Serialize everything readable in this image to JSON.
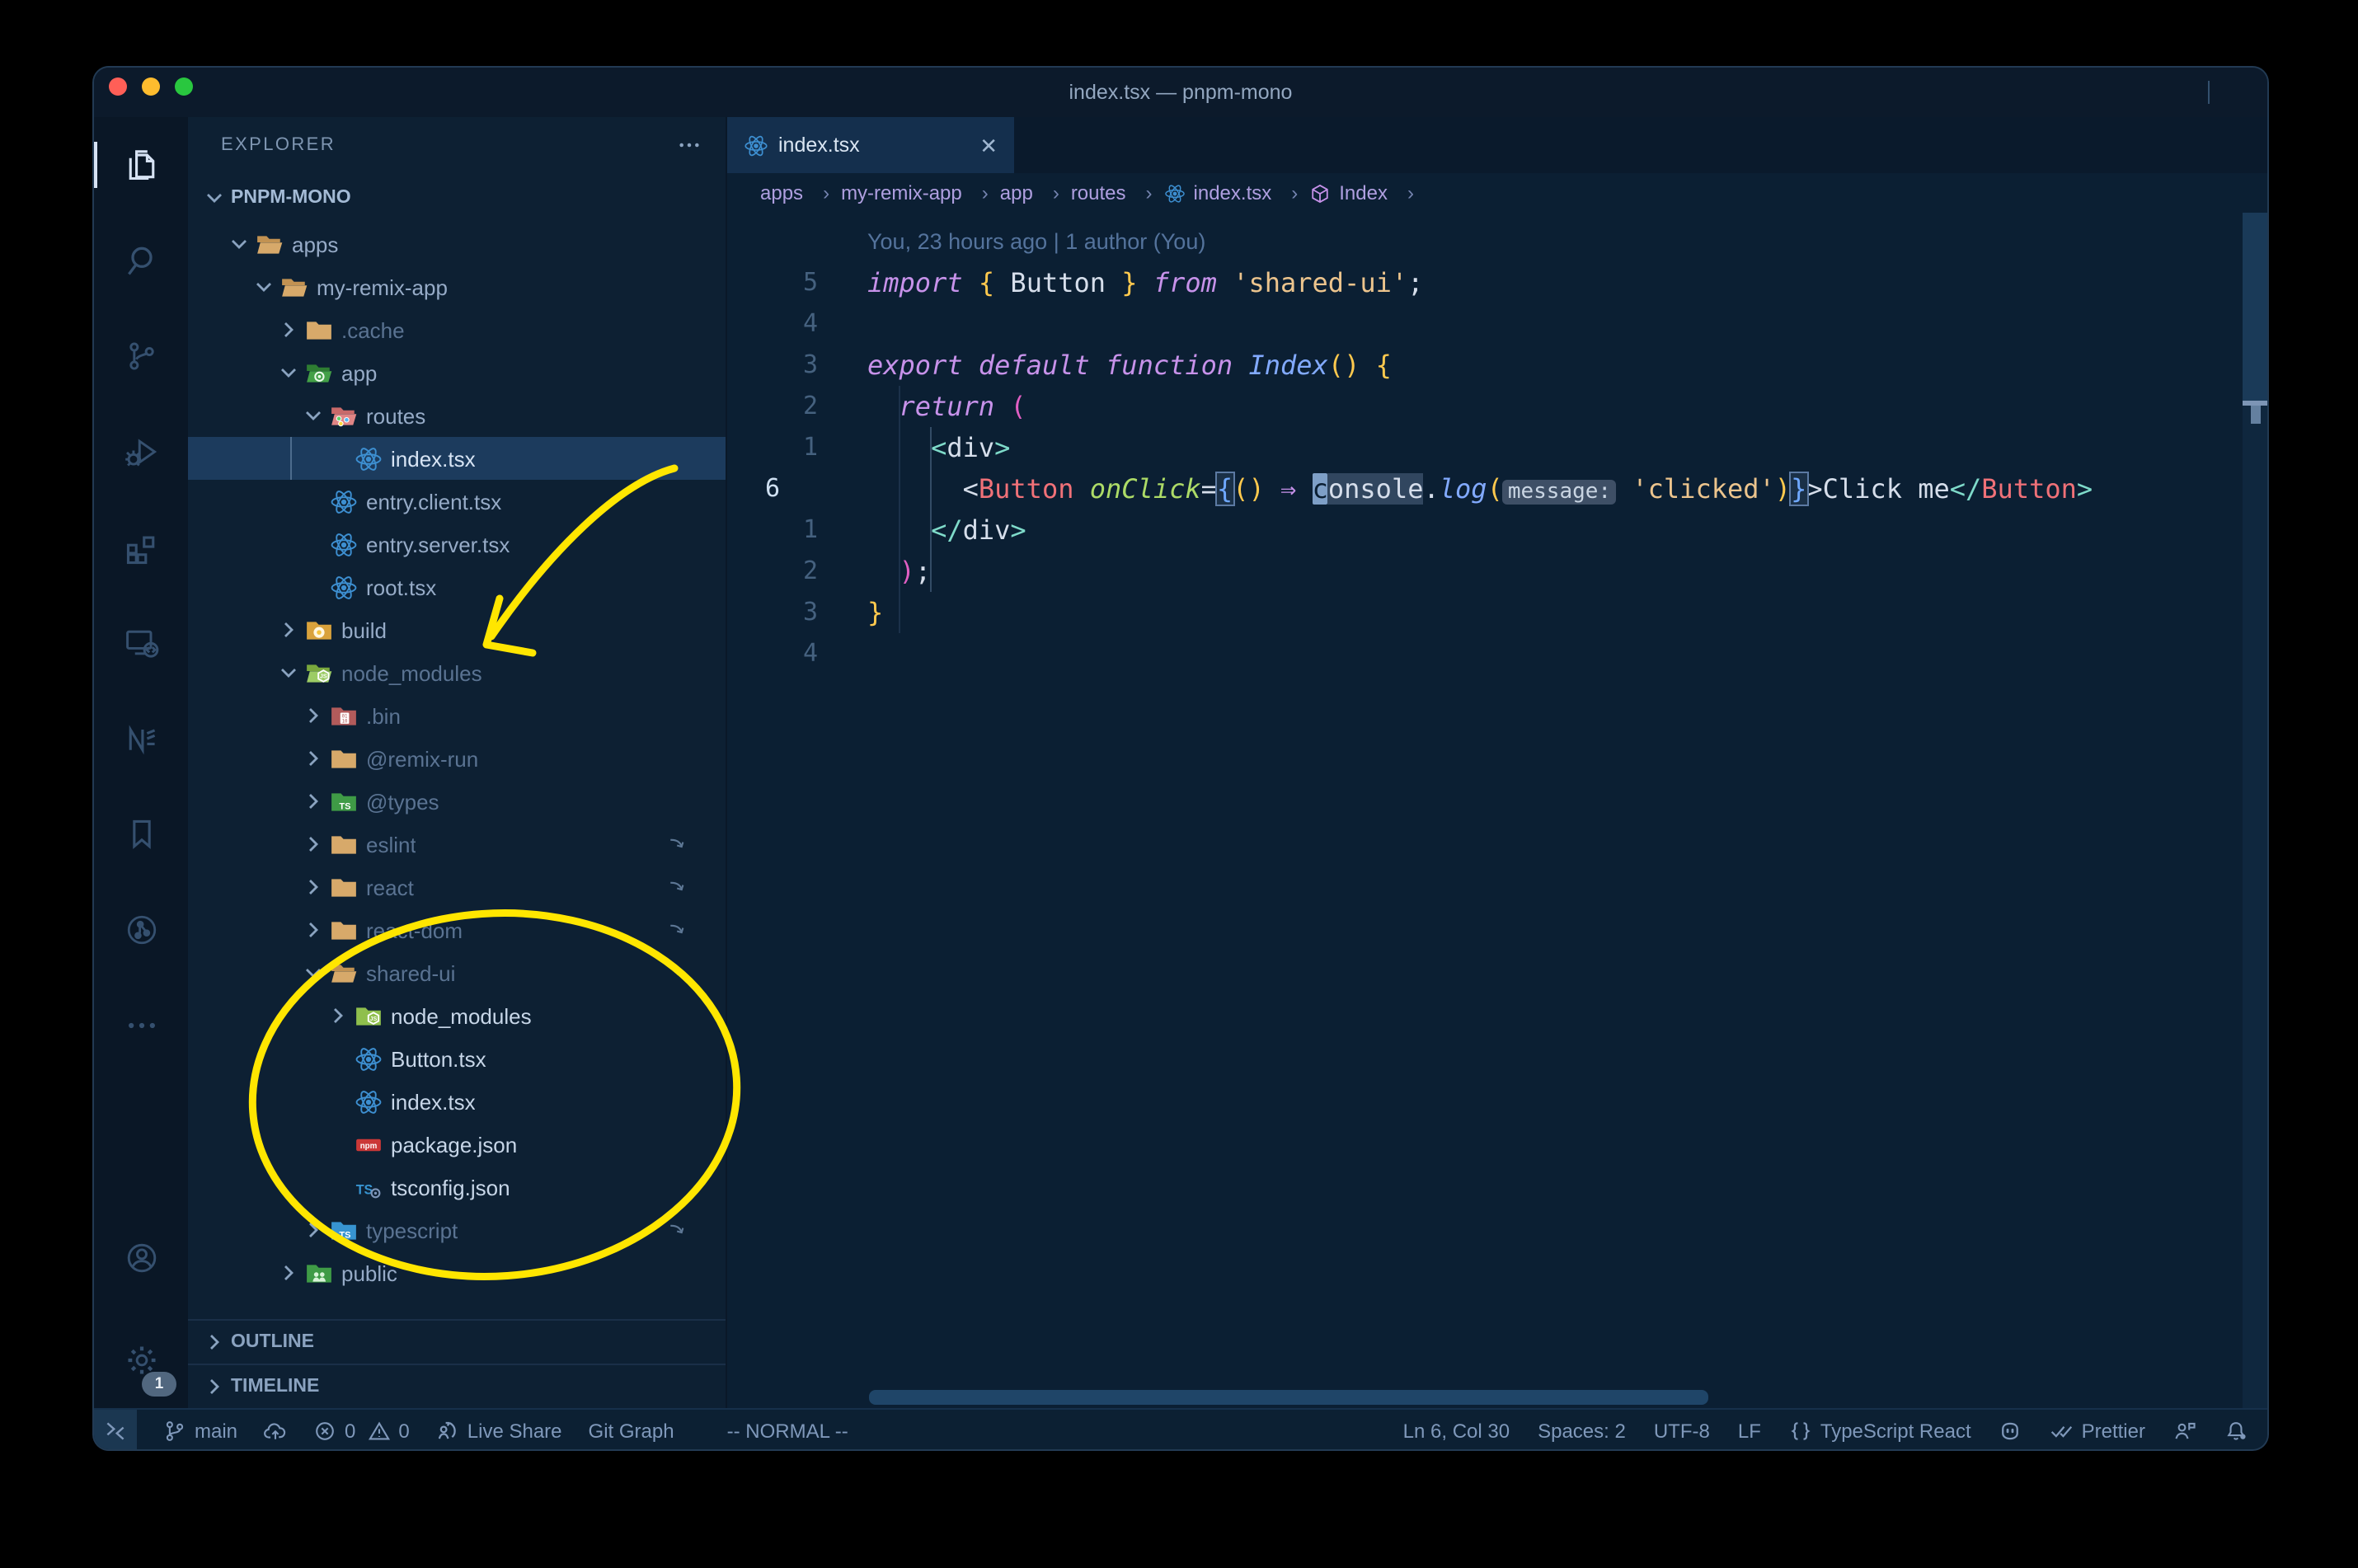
{
  "titlebar": {
    "title": "index.tsx — pnpm-mono",
    "traffic_lights": [
      "#ff5f57",
      "#febc2e",
      "#29c73f"
    ],
    "window_icons": [
      {
        "name": "toggle-primary-sidebar-button",
        "icon": "panel-left"
      },
      {
        "name": "toggle-panel-button",
        "icon": "panel-bottom"
      },
      {
        "name": "toggle-secondary-sidebar-button",
        "icon": "panel-right"
      },
      {
        "name": "divider",
        "icon": "",
        "cls": "divider"
      },
      {
        "name": "customize-layout-button",
        "icon": "layout"
      }
    ]
  },
  "activity_bar": {
    "items": [
      {
        "name": "activity-explorer",
        "icon": "files",
        "cls": "active"
      },
      {
        "name": "activity-search",
        "icon": "search"
      },
      {
        "name": "activity-source-control",
        "icon": "scm"
      },
      {
        "name": "activity-run-debug",
        "icon": "debug"
      },
      {
        "name": "activity-extensions",
        "icon": "extensions"
      },
      {
        "name": "activity-remote-explorer",
        "icon": "remote-explorer"
      },
      {
        "name": "activity-nx-console",
        "icon": "nx"
      },
      {
        "name": "activity-bookmarks",
        "icon": "bookmark"
      },
      {
        "name": "activity-git-graph",
        "icon": "graph-circle"
      },
      {
        "name": "activity-more",
        "icon": "more"
      }
    ],
    "settings_badge": "1"
  },
  "sidebar": {
    "header": "EXPLORER",
    "more_icon": "more",
    "section": "PNPM-MONO",
    "section_chevron": "chev-down",
    "tree": [
      {
        "name": "tree-folder-apps",
        "label": "apps",
        "depth": 1,
        "chev": "chev-down",
        "icon": "folder-open"
      },
      {
        "name": "tree-folder-my-remix-app",
        "label": "my-remix-app",
        "depth": 2,
        "chev": "chev-down",
        "icon": "folder-open"
      },
      {
        "name": "tree-folder-cache",
        "label": ".cache",
        "depth": 3,
        "chev": "chev-right",
        "ic4on": "",
        "icon": "folder",
        "cls": "dim"
      },
      {
        "name": "tree-folder-app",
        "label": "app",
        "depth": 3,
        "chev": "chev-down",
        "icon": "folder-app"
      },
      {
        "name": "tree-folder-routes",
        "label": "routes",
        "depth": 4,
        "chev": "chev-down",
        "icon": "folder-routes"
      },
      {
        "name": "tree-file-index-tsx",
        "label": "index.tsx",
        "depth": 5,
        "icon": "react",
        "cls": "selected"
      },
      {
        "name": "tree-file-entry-client",
        "label": "entry.client.tsx",
        "depth": 4,
        "icon": "react"
      },
      {
        "name": "tree-file-entry-server",
        "label": "entry.server.tsx",
        "depth": 4,
        "icon": "react"
      },
      {
        "name": "tree-file-root-tsx",
        "label": "root.tsx",
        "depth": 4,
        "icon": "react"
      },
      {
        "name": "tree-folder-build",
        "label": "build",
        "depth": 3,
        "chev": "chev-right",
        "icon": "folder-build"
      },
      {
        "name": "tree-folder-node-modules",
        "label": "node_modules",
        "depth": 3,
        "chev": "chev-down",
        "icon": "folder-node-open",
        "cls": "dim"
      },
      {
        "name": "tree-folder-bin",
        "label": ".bin",
        "depth": 4,
        "chev": "chev-right",
        "icon": "folder-bin",
        "cls": "dim"
      },
      {
        "name": "tree-folder-remix-run",
        "label": "@remix-run",
        "depth": 4,
        "chev": "chev-right",
        "icon": "folder",
        "cls": "dim"
      },
      {
        "name": "tree-folder-types",
        "label": "@types",
        "depth": 4,
        "chev": "chev-right",
        "icon": "folder-types",
        "cls": "dim"
      },
      {
        "name": "tree-folder-eslint",
        "label": "eslint",
        "depth": 4,
        "chev": "chev-right",
        "icon": "folder",
        "cls": "dim",
        "link": "symlink"
      },
      {
        "name": "tree-folder-react",
        "label": "react",
        "depth": 4,
        "chev": "chev-right",
        "icon": "folder",
        "cls": "dim",
        "link": "symlink"
      },
      {
        "name": "tree-folder-react-dom",
        "label": "react-dom",
        "depth": 4,
        "chev": "chev-right",
        "icon": "folder",
        "cls": "dim",
        "link": "symlink"
      },
      {
        "name": "tree-folder-shared-ui",
        "label": "shared-ui",
        "depth": 4,
        "chev": "chev-down",
        "icon": "folder-open",
        "cls": "dim",
        "link": "symlink"
      },
      {
        "name": "tree-folder-shared-node-modules",
        "label": "node_modules",
        "depth": 5,
        "chev": "chev-right",
        "icon": "folder-node",
        "cls": "bright"
      },
      {
        "name": "tree-file-button-tsx",
        "label": "Button.tsx",
        "depth": 5,
        "icon": "react",
        "cls": "bright"
      },
      {
        "name": "tree-file-shared-index-tsx",
        "label": "index.tsx",
        "depth": 5,
        "icon": "react",
        "cls": "bright"
      },
      {
        "name": "tree-file-package-json",
        "label": "package.json",
        "depth": 5,
        "icon": "npm",
        "cls": "bright"
      },
      {
        "name": "tree-file-tsconfig-json",
        "label": "tsconfig.json",
        "depth": 5,
        "icon": "tsconfig",
        "cls": "bright"
      },
      {
        "name": "tree-folder-typescript",
        "label": "typescript",
        "depth": 4,
        "chev": "chev-right",
        "icon": "folder-ts",
        "cls": "dim",
        "link": "symlink"
      },
      {
        "name": "tree-folder-public",
        "label": "public",
        "depth": 3,
        "chev": "chev-right",
        "icon": "folder-public"
      }
    ],
    "outline_label": "OUTLINE",
    "timeline_label": "TIMELINE",
    "panel_chevron": "chev-right"
  },
  "tab": {
    "icon": "react",
    "label": "index.tsx",
    "close": "✕"
  },
  "editor_actions": [
    {
      "name": "timeline-history-button",
      "icon": "history"
    },
    {
      "name": "previous-change-button",
      "icon": "prev-change"
    },
    {
      "name": "open-changes-button",
      "icon": "cur-change"
    },
    {
      "name": "next-change-button",
      "icon": "next-change"
    },
    {
      "name": "gitlens-graph-button",
      "icon": "graph-circle"
    },
    {
      "name": "split-editor-button",
      "icon": "split"
    },
    {
      "name": "more-actions-button",
      "icon": "more"
    }
  ],
  "breadcrumbs": [
    {
      "text": "apps"
    },
    {
      "text": "my-remix-app"
    },
    {
      "text": "app"
    },
    {
      "text": "routes"
    },
    {
      "icon": "react",
      "text": "index.tsx"
    },
    {
      "icon": "symbol-cube",
      "text": "Index"
    }
  ],
  "editor": {
    "blame": "You, 23 hours ago | 1 author (You)",
    "lines": [
      {
        "num": "5",
        "tokens": [
          {
            "t": "import",
            "c": "kw"
          },
          {
            "t": " ",
            "c": "w"
          },
          {
            "t": "{",
            "c": "y"
          },
          {
            "t": " Button ",
            "c": "w"
          },
          {
            "t": "}",
            "c": "y"
          },
          {
            "t": " ",
            "c": "w"
          },
          {
            "t": "from",
            "c": "kw"
          },
          {
            "t": " ",
            "c": "w"
          },
          {
            "t": "'shared-ui'",
            "c": "s"
          },
          {
            "t": ";",
            "c": "w"
          }
        ]
      },
      {
        "num": "4",
        "tokens": []
      },
      {
        "num": "3",
        "tokens": [
          {
            "t": "export",
            "c": "kw"
          },
          {
            "t": " ",
            "c": "w"
          },
          {
            "t": "default",
            "c": "kw"
          },
          {
            "t": " ",
            "c": "w"
          },
          {
            "t": "function",
            "c": "kw"
          },
          {
            "t": " ",
            "c": "w"
          },
          {
            "t": "Index",
            "c": "fn"
          },
          {
            "t": "(",
            "c": "y"
          },
          {
            "t": ")",
            "c": "y"
          },
          {
            "t": " ",
            "c": "w"
          },
          {
            "t": "{",
            "c": "y"
          }
        ]
      },
      {
        "num": "2",
        "tokens": [
          {
            "t": "  ",
            "c": "w"
          },
          {
            "t": "return",
            "c": "kw"
          },
          {
            "t": " ",
            "c": "w"
          },
          {
            "t": "(",
            "c": "pk"
          }
        ]
      },
      {
        "num": "1",
        "tokens": [
          {
            "t": "    ",
            "c": "w"
          },
          {
            "t": "<",
            "c": "tg"
          },
          {
            "t": "div",
            "c": "w"
          },
          {
            "t": ">",
            "c": "tg"
          }
        ]
      },
      {
        "num": "6",
        "cls": "cur-line",
        "tokens": [
          {
            "t": "      ",
            "c": "w"
          },
          {
            "t": "<",
            "c": "w"
          },
          {
            "t": "Button",
            "c": "cm"
          },
          {
            "t": " ",
            "c": "w"
          },
          {
            "t": "onClick",
            "c": "at"
          },
          {
            "t": "=",
            "c": "w"
          },
          {
            "t": "{",
            "c": "bl mb"
          },
          {
            "t": "(",
            "c": "y"
          },
          {
            "t": ")",
            "c": "y"
          },
          {
            "t": " ",
            "c": "w"
          },
          {
            "t": "⇒",
            "c": "arw"
          },
          {
            "t": " ",
            "c": "w"
          },
          {
            "t": "c",
            "c": "cur"
          },
          {
            "t": "onsole",
            "c": "w hl"
          },
          {
            "t": ".",
            "c": "w"
          },
          {
            "t": "log",
            "c": "fn"
          },
          {
            "t": "(",
            "c": "y"
          },
          {
            "t": "message:",
            "c": "inlay"
          },
          {
            "t": " ",
            "c": "w"
          },
          {
            "t": "'clicked'",
            "c": "s"
          },
          {
            "t": ")",
            "c": "y"
          },
          {
            "t": "}",
            "c": "bl mb"
          },
          {
            "t": ">",
            "c": "w"
          },
          {
            "t": "Click me",
            "c": "w"
          },
          {
            "t": "</",
            "c": "tg"
          },
          {
            "t": "Button",
            "c": "cm"
          },
          {
            "t": ">",
            "c": "tg"
          }
        ]
      },
      {
        "num": "1",
        "tokens": [
          {
            "t": "    ",
            "c": "w"
          },
          {
            "t": "</",
            "c": "tg"
          },
          {
            "t": "div",
            "c": "w"
          },
          {
            "t": ">",
            "c": "tg"
          }
        ]
      },
      {
        "num": "2",
        "tokens": [
          {
            "t": "  ",
            "c": "w"
          },
          {
            "t": ")",
            "c": "pk"
          },
          {
            "t": ";",
            "c": "w"
          }
        ]
      },
      {
        "num": "3",
        "tokens": [
          {
            "t": "}",
            "c": "y"
          }
        ]
      },
      {
        "num": "4",
        "tokens": []
      }
    ]
  },
  "status_bar": {
    "left": [
      {
        "name": "remote-indicator",
        "icon": "remote",
        "cls": "remote"
      },
      {
        "name": "git-branch-item",
        "icon": "git-branch",
        "text": "main"
      },
      {
        "name": "sync-changes-button",
        "icon": "cloud-upload"
      },
      {
        "name": "errors-count",
        "icon": "error-circle",
        "text": "0"
      },
      {
        "name": "warnings-count",
        "icon": "warning",
        "text": "0",
        "cls": "tight"
      },
      {
        "name": "live-share-button",
        "icon": "live-share",
        "text": "Live Share"
      },
      {
        "name": "git-graph-button",
        "text": "Git Graph"
      },
      {
        "name": "vim-mode-indicator",
        "text": "-- NORMAL --",
        "cls": "pad"
      }
    ],
    "right": [
      {
        "name": "cursor-position",
        "text": "Ln 6, Col 30"
      },
      {
        "name": "indentation",
        "text": "Spaces: 2"
      },
      {
        "name": "encoding",
        "text": "UTF-8"
      },
      {
        "name": "eol-sequence",
        "text": "LF"
      },
      {
        "name": "language-mode",
        "icon": "braces",
        "text": "TypeScript React"
      },
      {
        "name": "copilot-status",
        "icon": "copilot"
      },
      {
        "name": "formatter-prettier",
        "icon": "double-check",
        "text": "Prettier"
      },
      {
        "name": "feedback-button",
        "icon": "feedback"
      },
      {
        "name": "notifications-bell",
        "icon": "bell"
      }
    ]
  },
  "colors": {
    "annotation_yellow": "#ffe600",
    "editor_background": "#0b1f33",
    "selection_row": "#1c3b5d",
    "active_tab": "#142f4d"
  }
}
